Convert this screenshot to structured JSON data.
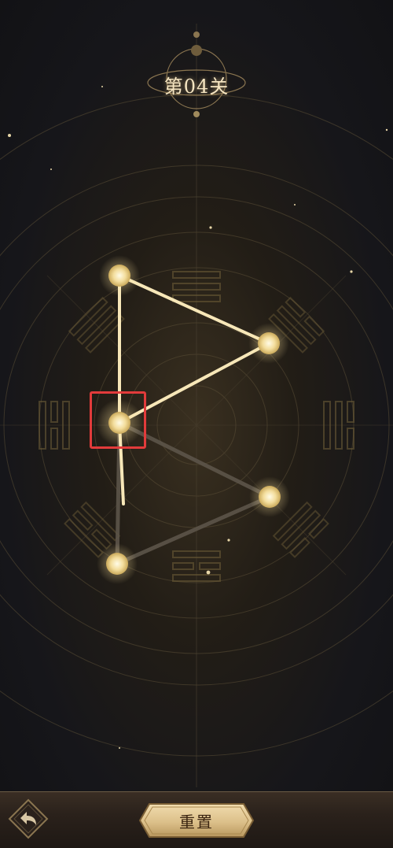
{
  "level": {
    "label": "第04关"
  },
  "controls": {
    "reset_label": "重置",
    "back_icon": "back-arrow-icon"
  },
  "puzzle": {
    "node_count": 5,
    "drawn_edges": [
      [
        "top",
        "mid-left"
      ],
      [
        "top",
        "right-upper"
      ],
      [
        "right-upper",
        "mid-left"
      ]
    ],
    "remaining_edges": [
      [
        "mid-left",
        "right-lower"
      ],
      [
        "right-lower",
        "bottom"
      ],
      [
        "bottom",
        "mid-left"
      ]
    ],
    "selected_node": "mid-left"
  },
  "colors": {
    "glow": "#fff1c4",
    "line_active": "#f7e7b8",
    "line_inactive": "#5a5248",
    "selection": "#e23b3b",
    "button_gold": "#e2c48c"
  }
}
